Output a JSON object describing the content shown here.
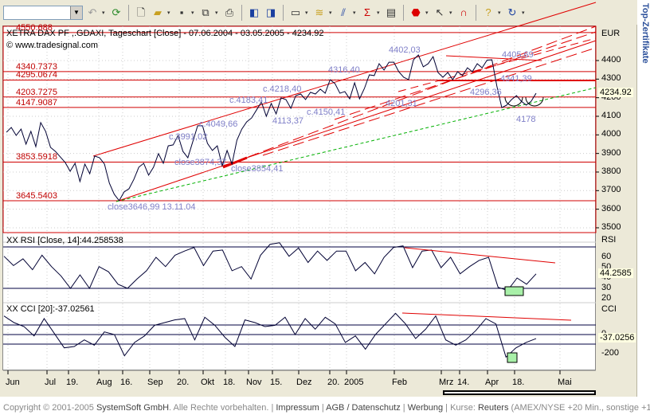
{
  "toolbar": {
    "symbol_value": "",
    "icons": [
      "back-arrow-icon",
      "refresh-icon",
      "new-document-icon",
      "open-folder-icon",
      "save-icon",
      "copy-icon",
      "print-icon",
      "chart-left-icon",
      "chart-right-icon",
      "window-icon",
      "indicator-icon",
      "drawing-tools-icon",
      "sigma-icon",
      "properties-icon",
      "stop-icon",
      "pointer-icon",
      "magnet-icon",
      "help-icon",
      "undo-icon"
    ]
  },
  "chart": {
    "title": "XETRA DAX PF ,.GDAXI, Tageschart [Close] - 07.06.2004 - 03.05.2005 - 4234.92",
    "copyright": "© www.tradesignal.com",
    "currency": "EUR",
    "last_value": "4234.92",
    "price_ticks": [
      "4400",
      "4300",
      "4200",
      "4100",
      "4000",
      "3900",
      "3800",
      "3700",
      "3600",
      "3500"
    ],
    "levels": [
      {
        "label": "4550.688",
        "value": 4550.688
      },
      {
        "label": "4340.7373",
        "value": 4340.7373
      },
      {
        "label": "4295.0674",
        "value": 4295.0674
      },
      {
        "label": "4203.7275",
        "value": 4203.7275
      },
      {
        "label": "4147.9087",
        "value": 4147.9087
      },
      {
        "label": "3853.5918",
        "value": 3853.5918
      },
      {
        "label": "3645.5403",
        "value": 3645.5403
      }
    ],
    "annotations": [
      "close3646,99   13.11.04",
      "c.3991,02",
      "c.4049,66",
      "close3874,37",
      "close3854,41",
      "c.4183,41",
      "c.4218,40",
      "4113,37",
      "c.4150,41",
      "4316,40",
      "4201,31",
      "4402,03",
      "4405,69",
      "4341,39",
      "4296,36",
      "4178"
    ],
    "closes": [
      4014,
      4040,
      3997,
      4031,
      3950,
      4019,
      3937,
      4066,
      4019,
      3933,
      3911,
      3881,
      3851,
      3804,
      3847,
      3749,
      3843,
      3791,
      3886,
      3877,
      3843,
      3740,
      3680,
      3646,
      3693,
      3710,
      3761,
      3826,
      3847,
      3783,
      3826,
      3899,
      3847,
      3941,
      3946,
      3997,
      3911,
      3877,
      3963,
      4049,
      4049,
      3954,
      3916,
      3941,
      3834,
      3916,
      3843,
      3971,
      4031,
      4070,
      4091,
      4134,
      4177,
      4100,
      4169,
      4113,
      4199,
      4190,
      4143,
      4211,
      4220,
      4190,
      4229,
      4220,
      4246,
      4224,
      4297,
      4276,
      4224,
      4233,
      4194,
      4280,
      4194,
      4250,
      4323,
      4319,
      4383,
      4349,
      4391,
      4391,
      4340,
      4310,
      4297,
      4404,
      4430,
      4366,
      4383,
      4421,
      4336,
      4310,
      4336,
      4297,
      4340,
      4319,
      4361,
      4340,
      4383,
      4361,
      4402,
      4404,
      4263,
      4147,
      4160,
      4190,
      4211,
      4181,
      4160,
      4181,
      4224
    ],
    "ylim": [
      3500,
      4400
    ]
  },
  "rsi": {
    "title": "XX RSI [Close, 14]:44.258538",
    "axis_label": "RSI",
    "ticks": [
      "60",
      "50",
      "40",
      "30",
      "20"
    ],
    "last_value": "44.2585",
    "levels": [
      70,
      30
    ],
    "values": [
      61,
      52,
      58.5,
      48,
      62,
      51,
      42,
      30,
      43,
      30,
      51,
      46,
      34,
      30,
      39,
      47,
      60,
      51,
      62,
      66,
      69.5,
      52,
      66,
      67,
      47,
      51,
      39,
      62,
      72.5,
      74,
      61,
      69,
      55,
      66,
      57,
      66,
      66,
      47,
      55,
      44,
      60,
      69.5,
      71,
      50,
      66,
      67,
      50,
      60,
      44,
      51,
      57,
      60,
      31,
      28,
      40,
      34,
      44
    ]
  },
  "cci": {
    "title": "XX CCI [20]:-37.02561",
    "axis_label": "CCI",
    "ticks": [
      "0",
      "-200"
    ],
    "last_value": "-37.0256",
    "levels": [
      100,
      0,
      -100
    ],
    "values": [
      194,
      125,
      83,
      -14,
      167,
      14,
      -139,
      -125,
      -56,
      -111,
      28,
      0,
      -222,
      -83,
      -14,
      97,
      125,
      153,
      167,
      -56,
      181,
      97,
      -28,
      -125,
      153,
      125,
      83,
      97,
      181,
      0,
      167,
      56,
      181,
      111,
      -83,
      -14,
      -153,
      0,
      111,
      222,
      111,
      -42,
      56,
      194,
      -56,
      -111,
      -56,
      42,
      167,
      111,
      -236,
      -139,
      -83,
      -42
    ]
  },
  "xaxis": {
    "labels": [
      "Jun",
      "Jul",
      "19.",
      "Aug",
      "16.",
      "Sep",
      "20.",
      "Okt",
      "18.",
      "Nov",
      "15.",
      "Dez",
      "20.",
      "2005",
      "Feb",
      "Mrz",
      "14.",
      "Apr",
      "18.",
      "Mai"
    ]
  },
  "sidebar": {
    "title": "Top-Zertifikate"
  },
  "footer": {
    "copyright": "Copyright © 2001-2005 ",
    "company": "SystemSoft GmbH",
    "rights": ". Alle Rechte vorbehalten. | ",
    "impressum": "Impressum",
    "sep1": " | ",
    "agb": "AGB / Datenschutz",
    "sep2": " | ",
    "werbung": "Werbung",
    "sep3": " | Kurse: ",
    "reuters": "Reuters",
    "rest": " (AMEX/NYSE +20 Min., sonstige +1"
  },
  "colors": {
    "price": "#000033",
    "levels": "#d00000",
    "trend": "#e00000",
    "support": "#00b000",
    "annotation": "#7f7fc8",
    "signal_box": "#a8f0a8"
  }
}
